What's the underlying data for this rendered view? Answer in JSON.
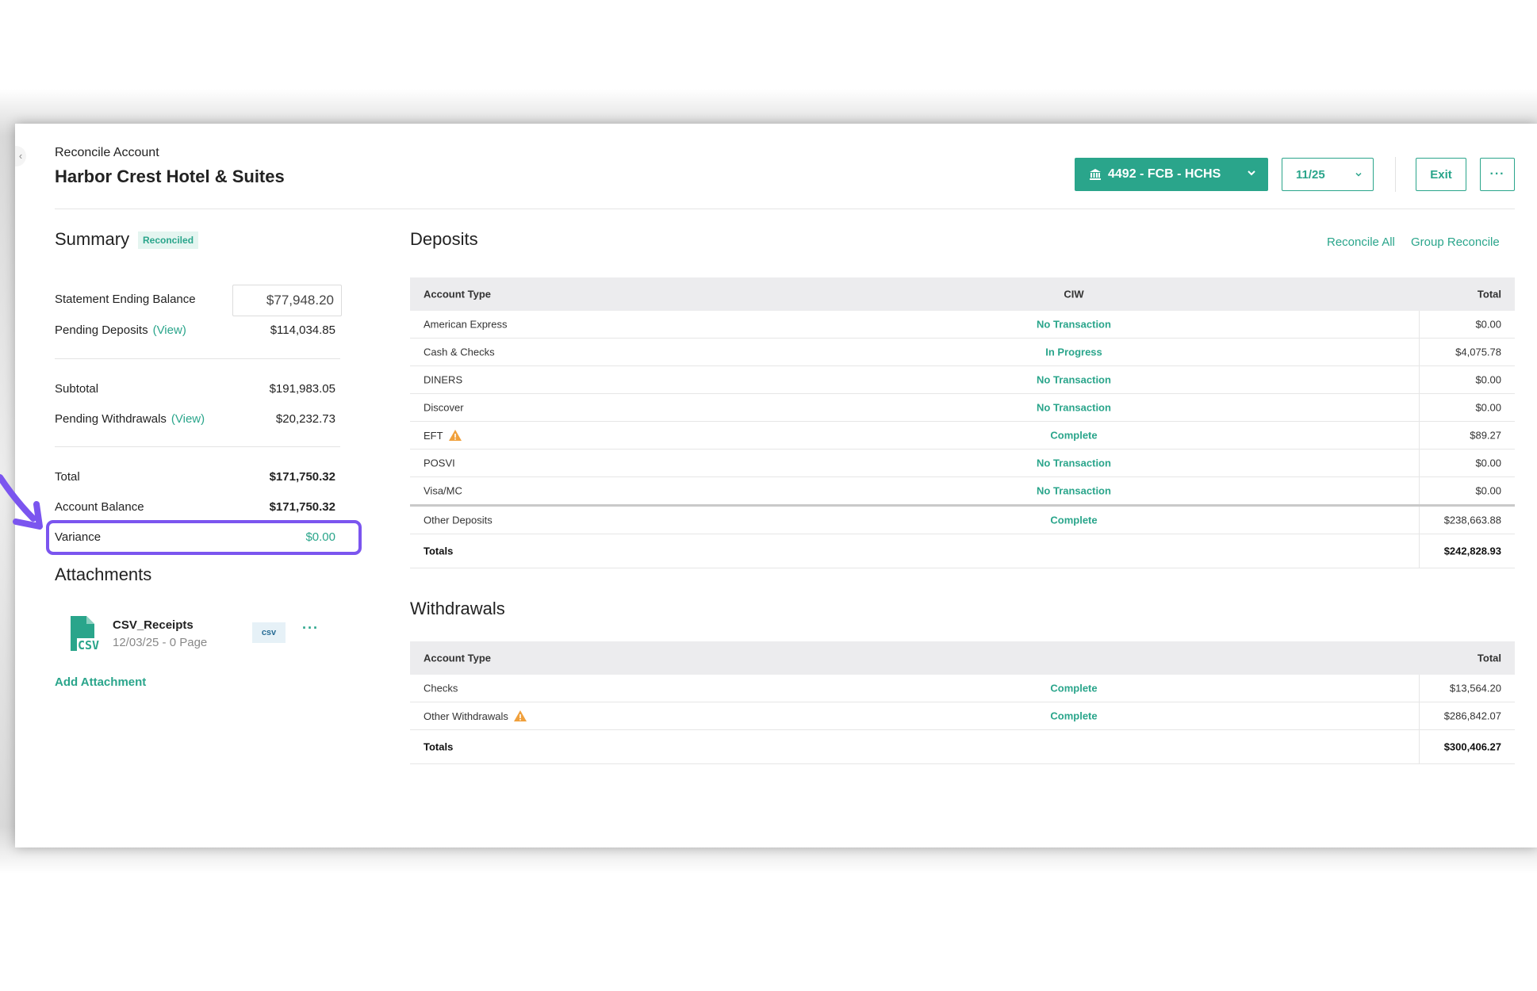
{
  "header": {
    "breadcrumb": "Reconcile Account",
    "title": "Harbor Crest Hotel & Suites",
    "account_select": "4492 - FCB - HCHS",
    "period_select": "11/25",
    "exit_label": "Exit",
    "more_label": "···"
  },
  "summary": {
    "title": "Summary",
    "badge": "Reconciled",
    "statement_ending_balance_label": "Statement Ending Balance",
    "statement_ending_balance_value": "$77,948.20",
    "pending_deposits_label": "Pending Deposits",
    "pending_deposits_view": "(View)",
    "pending_deposits_value": "$114,034.85",
    "subtotal_label": "Subtotal",
    "subtotal_value": "$191,983.05",
    "pending_withdrawals_label": "Pending Withdrawals",
    "pending_withdrawals_view": "(View)",
    "pending_withdrawals_value": "$20,232.73",
    "total_label": "Total",
    "total_value": "$171,750.32",
    "account_balance_label": "Account Balance",
    "account_balance_value": "$171,750.32",
    "variance_label": "Variance",
    "variance_value": "$0.00"
  },
  "attachments": {
    "title": "Attachments",
    "file_name": "CSV_Receipts",
    "file_meta": "12/03/25 - 0 Page",
    "file_badge": "csv",
    "file_icon_text": "CSV",
    "more_label": "···",
    "add_label": "Add Attachment"
  },
  "deposits": {
    "title": "Deposits",
    "reconcile_all": "Reconcile All",
    "group_reconcile": "Group Reconcile",
    "headers": {
      "type": "Account Type",
      "ciw": "CIW",
      "total": "Total"
    },
    "rows": [
      {
        "type": "American Express",
        "ciw": "No Transaction",
        "total": "$0.00",
        "warning": false
      },
      {
        "type": "Cash & Checks",
        "ciw": "In Progress",
        "total": "$4,075.78",
        "warning": false
      },
      {
        "type": "DINERS",
        "ciw": "No Transaction",
        "total": "$0.00",
        "warning": false
      },
      {
        "type": "Discover",
        "ciw": "No Transaction",
        "total": "$0.00",
        "warning": false
      },
      {
        "type": "EFT",
        "ciw": "Complete",
        "total": "$89.27",
        "warning": true
      },
      {
        "type": "POSVI",
        "ciw": "No Transaction",
        "total": "$0.00",
        "warning": false
      },
      {
        "type": "Visa/MC",
        "ciw": "No Transaction",
        "total": "$0.00",
        "warning": false
      },
      {
        "type": "Other Deposits",
        "ciw": "Complete",
        "total": "$238,663.88",
        "warning": false
      }
    ],
    "totals_label": "Totals",
    "totals_value": "$242,828.93"
  },
  "withdrawals": {
    "title": "Withdrawals",
    "headers": {
      "type": "Account Type",
      "total": "Total"
    },
    "rows": [
      {
        "type": "Checks",
        "ciw": "Complete",
        "total": "$13,564.20",
        "warning": false
      },
      {
        "type": "Other Withdrawals",
        "ciw": "Complete",
        "total": "$286,842.07",
        "warning": true
      }
    ],
    "totals_label": "Totals",
    "totals_value": "$300,406.27"
  },
  "colors": {
    "accent": "#2aa58b",
    "annotation": "#7b55ef",
    "warning": "#f0a03c"
  }
}
